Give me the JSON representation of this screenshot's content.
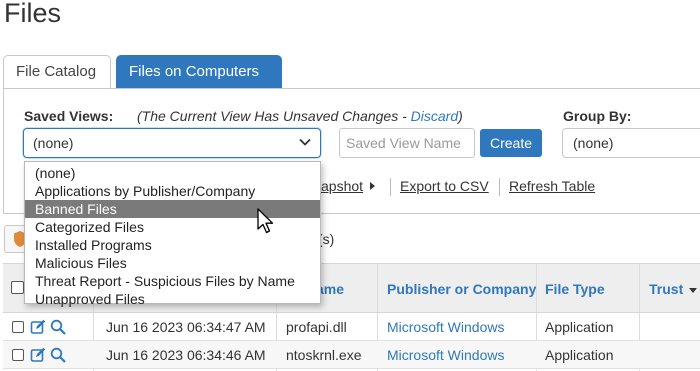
{
  "page": {
    "title": "Files"
  },
  "tabs": [
    {
      "label": "File Catalog",
      "active": false
    },
    {
      "label": "Files on Computers",
      "active": true
    }
  ],
  "filters": {
    "saved_views_label": "Saved Views:",
    "unsaved_prefix": "(The Current View Has Unsaved Changes - ",
    "discard_label": "Discard",
    "unsaved_suffix": ")",
    "saved_views_value": "(none)",
    "saved_view_name_placeholder": "Saved View Name",
    "create_label": "Create",
    "group_by_label": "Group By:",
    "group_by_value": "(none)"
  },
  "toolbar": {
    "snapshot_label": "apshot",
    "export_label": "Export to CSV",
    "refresh_label": "Refresh Table"
  },
  "count_tail": "(s)",
  "dropdown": {
    "options": [
      "(none)",
      "Applications by Publisher/Company",
      "Banned Files",
      "Categorized Files",
      "Installed Programs",
      "Malicious Files",
      "Threat Report - Suspicious Files by Name",
      "Unapproved Files"
    ],
    "highlighted": "Banned Files"
  },
  "table": {
    "columns": [
      "ame",
      "Publisher or Company",
      "File Type",
      "Trust"
    ],
    "rows": [
      {
        "date": "Jun 16 2023 06:34:47 AM",
        "name": "profapi.dll",
        "publisher": "Microsoft Windows",
        "type": "Application"
      },
      {
        "date": "Jun 16 2023 06:34:46 AM",
        "name": "ntoskrnl.exe",
        "publisher": "Microsoft Windows",
        "type": "Application"
      }
    ]
  },
  "colors": {
    "accent": "#2f78bd",
    "highlight": "#7a7a7a",
    "header_bg": "#eeeeee"
  }
}
